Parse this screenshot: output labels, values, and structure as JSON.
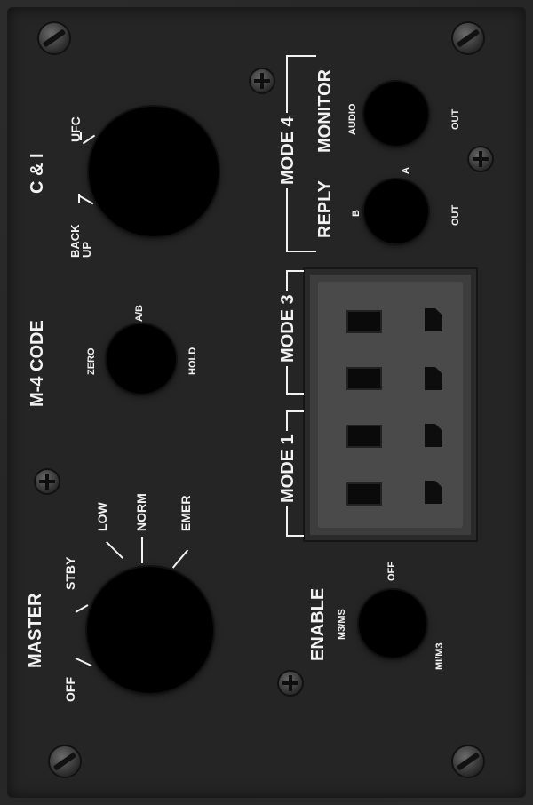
{
  "master": {
    "title": "MASTER",
    "off": "OFF",
    "stby": "STBY",
    "low": "LOW",
    "norm": "NORM",
    "emer": "EMER"
  },
  "m4code": {
    "title": "M-4 CODE",
    "ab": "A/B",
    "zero": "ZERO",
    "hold": "HOLD"
  },
  "ci": {
    "title": "C & I",
    "ufc": "UFC",
    "backup": "BACK UP"
  },
  "mode4": {
    "title": "MODE 4",
    "monitor": "MONITOR",
    "reply": "REPLY",
    "audio": "AUDIO",
    "out_top": "OUT",
    "a": "A",
    "b": "B",
    "out_bottom": "OUT"
  },
  "mode3": {
    "title": "MODE 3"
  },
  "mode1": {
    "title": "MODE 1"
  },
  "enable": {
    "title": "ENABLE",
    "m3ms": "M3/MS",
    "off": "OFF",
    "mim3": "MI/M3"
  }
}
